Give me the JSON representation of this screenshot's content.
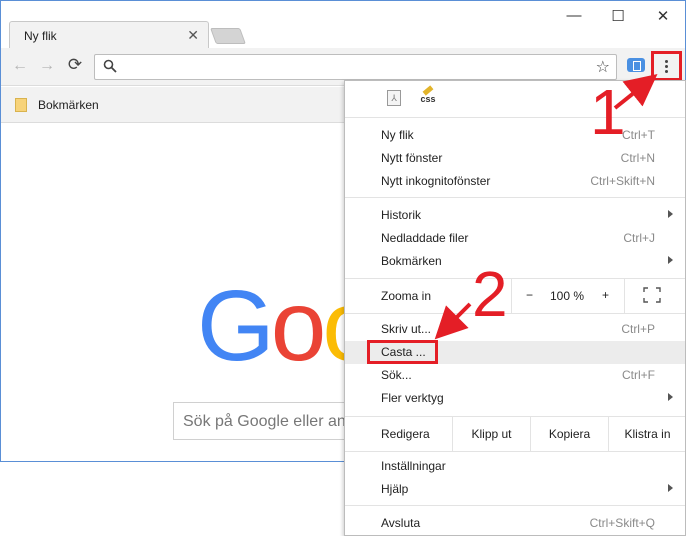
{
  "tab": {
    "title": "Ny flik",
    "close_glyph": "✕"
  },
  "window_controls": {
    "minimize": "—",
    "maximize": "☐",
    "close": "✕"
  },
  "toolbar": {
    "back": "←",
    "forward": "→",
    "reload": "⟳",
    "star": "☆"
  },
  "bookmarks_bar": {
    "folder_label": "Bokmärken"
  },
  "page": {
    "logo_letters": [
      "G",
      "o",
      "o"
    ],
    "search_placeholder": "Sök på Google eller an"
  },
  "menu": {
    "group1": [
      {
        "label": "Ny flik",
        "shortcut": "Ctrl+T"
      },
      {
        "label": "Nytt fönster",
        "shortcut": "Ctrl+N"
      },
      {
        "label": "Nytt inkognitofönster",
        "shortcut": "Ctrl+Skift+N"
      }
    ],
    "group2": [
      {
        "label": "Historik",
        "shortcut": ""
      },
      {
        "label": "Nedladdade filer",
        "shortcut": "Ctrl+J"
      },
      {
        "label": "Bokmärken",
        "shortcut": ""
      }
    ],
    "zoom": {
      "label": "Zooma in",
      "minus": "−",
      "value": "100 %",
      "plus": "+"
    },
    "group3": [
      {
        "label": "Skriv ut...",
        "shortcut": "Ctrl+P"
      },
      {
        "label": "Casta ...",
        "shortcut": ""
      },
      {
        "label": "Sök...",
        "shortcut": "Ctrl+F"
      },
      {
        "label": "Fler verktyg",
        "shortcut": ""
      }
    ],
    "edit": {
      "label": "Redigera",
      "cut": "Klipp ut",
      "copy": "Kopiera",
      "paste": "Klistra in"
    },
    "group4": [
      {
        "label": "Inställningar",
        "shortcut": ""
      },
      {
        "label": "Hjälp",
        "shortcut": ""
      }
    ],
    "group5": [
      {
        "label": "Avsluta",
        "shortcut": "Ctrl+Skift+Q"
      }
    ],
    "ext_icons": {
      "css_label": "css"
    }
  },
  "annotations": {
    "step1": "1",
    "step2": "2",
    "color": "#e41e26"
  }
}
